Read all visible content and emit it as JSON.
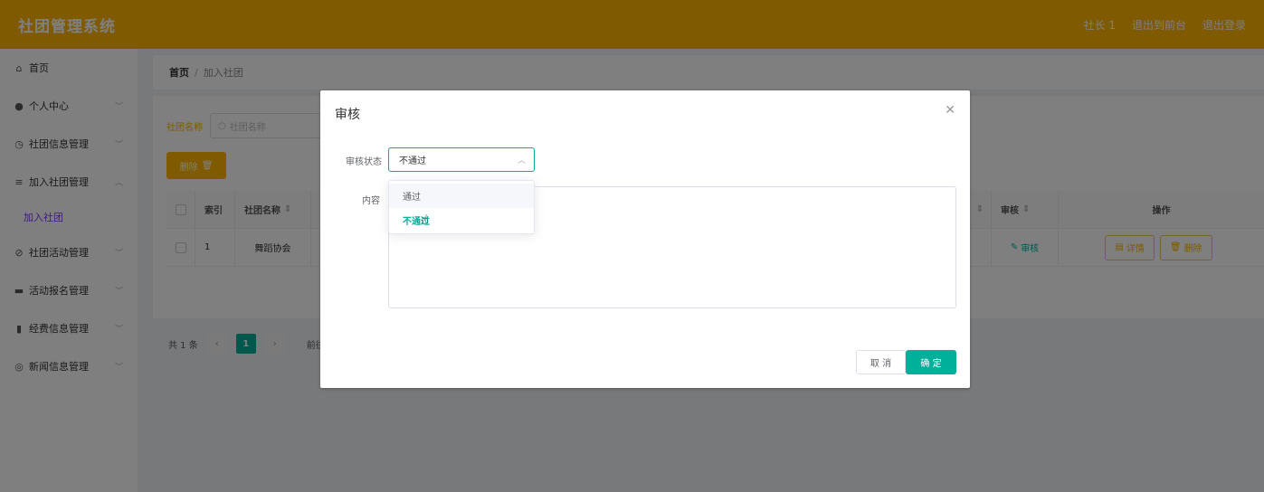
{
  "header": {
    "app_title": "社团管理系统",
    "user": "社长 1",
    "back_front": "退出到前台",
    "logout": "退出登录"
  },
  "sidebar": {
    "items": [
      {
        "label": "首页",
        "icon": "home-icon"
      },
      {
        "label": "个人中心",
        "icon": "user-icon"
      },
      {
        "label": "社团信息管理",
        "icon": "clock-icon"
      },
      {
        "label": "加入社团管理",
        "icon": "list-icon"
      },
      {
        "label": "加入社团",
        "icon": ""
      },
      {
        "label": "社团活动管理",
        "icon": "activity-icon"
      },
      {
        "label": "活动报名管理",
        "icon": "signup-icon"
      },
      {
        "label": "经费信息管理",
        "icon": "chart-icon"
      },
      {
        "label": "新闻信息管理",
        "icon": "news-icon"
      }
    ]
  },
  "breadcrumb": {
    "home": "首页",
    "separator": "/",
    "current": "加入社团"
  },
  "search": {
    "label": "社团名称",
    "placeholder": "社团名称"
  },
  "toolbar": {
    "delete_label": "删除"
  },
  "table": {
    "headers": {
      "index": "索引",
      "club_name": "社团名称",
      "audit": "审核",
      "ops": "操作"
    },
    "rows": [
      {
        "index": "1",
        "club_name": "舞蹈协会",
        "audit": "审核",
        "detail": "详情",
        "delete": "删除"
      }
    ]
  },
  "pager": {
    "total": "共 1 条",
    "page": "1",
    "goto": "前往"
  },
  "dialog": {
    "title": "审核",
    "status_label": "审核状态",
    "status_value": "不通过",
    "content_label": "内容",
    "cancel": "取 消",
    "confirm": "确 定",
    "options": [
      "通过",
      "不通过"
    ]
  }
}
